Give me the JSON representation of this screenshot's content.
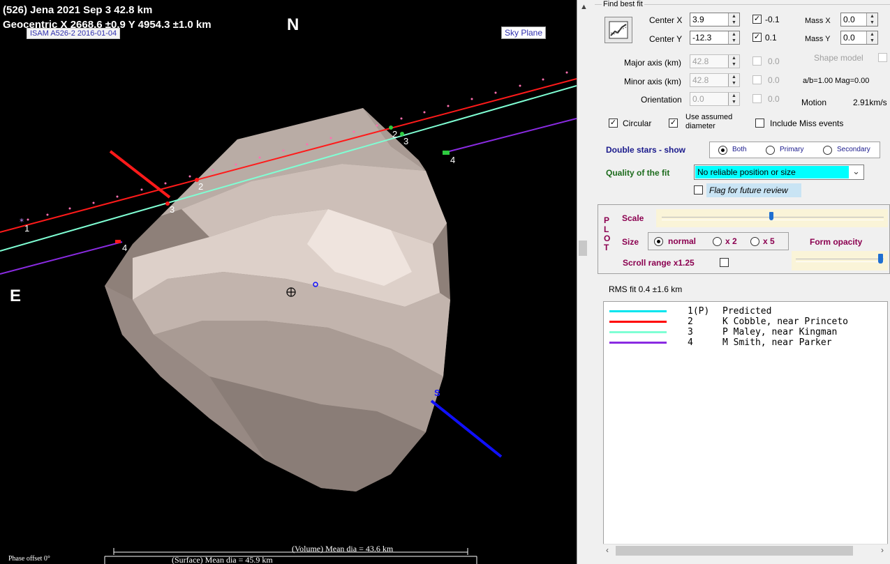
{
  "plot": {
    "title_line1": "(526) Jena  2021 Sep 3  42.8 km",
    "title_line2": "Geocentric  X  2668.6 ±0.9  Y 4954.3 ±1.0 km",
    "model_label": "ISAM A526-2 2016-01-04",
    "sky_plane_button": "Sky Plane",
    "north": "N",
    "east": "E",
    "south": "S",
    "phase_offset": "Phase offset 0°",
    "volume_dia": "(Volume) Mean dia = 43.6 km",
    "surface_dia": "(Surface) Mean dia = 45.9 km",
    "chord_labels": [
      "1",
      "2",
      "3",
      "4",
      "2",
      "3",
      "4"
    ]
  },
  "panel": {
    "find_best_fit": "Find best fit",
    "center_x_label": "Center X",
    "center_x_value": "3.9",
    "center_y_label": "Center Y",
    "center_y_value": "-12.3",
    "step_x": "-0.1",
    "step_y": "0.1",
    "mass_x_label": "Mass X",
    "mass_x_value": "0.0",
    "mass_y_label": "Mass Y",
    "mass_y_value": "0.0",
    "major_axis_label": "Major axis (km)",
    "major_axis_value": "42.8",
    "major_step": "0.0",
    "shape_model_label": "Shape model",
    "minor_axis_label": "Minor axis (km)",
    "minor_axis_value": "42.8",
    "minor_step": "0.0",
    "ab_mag": "a/b=1.00 Mag=0.00",
    "orientation_label": "Orientation",
    "orientation_value": "0.0",
    "orient_step": "0.0",
    "motion_label": "Motion",
    "motion_value": "2.91km/s",
    "circular_label": "Circular",
    "assumed_diameter_label_1": "Use assumed",
    "assumed_diameter_label_2": "diameter",
    "include_miss_label": "Include Miss events",
    "double_stars_label": "Double stars - show",
    "ds_both": "Both",
    "ds_primary": "Primary",
    "ds_secondary": "Secondary",
    "quality_label": "Quality of the fit",
    "quality_value": "No reliable position or size",
    "flag_review_label": "Flag for future review",
    "plot_letters": [
      "P",
      "L",
      "O",
      "T"
    ],
    "scale_label": "Scale",
    "size_label": "Size",
    "size_normal": "normal",
    "size_x2": "x 2",
    "size_x5": "x 5",
    "form_opacity_label": "Form opacity",
    "scroll_range_label": "Scroll range x1.25",
    "rms_fit": "RMS fit 0.4 ±1.6 km",
    "legend": [
      {
        "color": "#00e5ee",
        "num": "1(P)",
        "name": "Predicted"
      },
      {
        "color": "#ff0000",
        "num": "2",
        "name": "K Cobble, near Princeto"
      },
      {
        "color": "#7fffd4",
        "num": "3",
        "name": "P Maley, near Kingman"
      },
      {
        "color": "#8a2be2",
        "num": "4",
        "name": "M Smith, near Parker"
      }
    ]
  }
}
